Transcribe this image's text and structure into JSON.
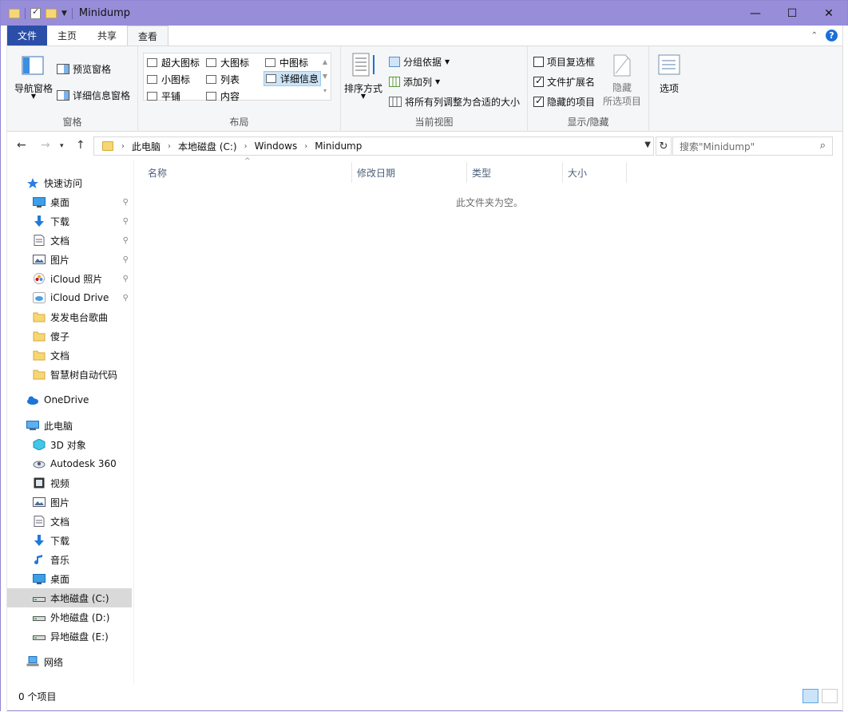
{
  "window": {
    "title": "Minidump"
  },
  "titlebar": {
    "minimize": "—",
    "maximize": "☐",
    "close": "✕"
  },
  "tabs": [
    {
      "label": "文件"
    },
    {
      "label": "主页"
    },
    {
      "label": "共享"
    },
    {
      "label": "查看"
    }
  ],
  "ribbon": {
    "panes": {
      "label": "窗格",
      "nav_pane": "导航窗格",
      "preview_pane": "预览窗格",
      "details_pane": "详细信息窗格"
    },
    "layout": {
      "label": "布局",
      "items": [
        "超大图标",
        "大图标",
        "中图标",
        "小图标",
        "列表",
        "详细信息",
        "平铺",
        "内容"
      ]
    },
    "current_view": {
      "label": "当前视图",
      "sort_by": "排序方式",
      "group_by": "分组依据",
      "add_columns": "添加列",
      "fit_columns": "将所有列调整为合适的大小"
    },
    "show_hide": {
      "label": "显示/隐藏",
      "item_checkboxes": "项目复选框",
      "file_extensions": "文件扩展名",
      "hidden_items": "隐藏的项目",
      "item_checkboxes_checked": false,
      "file_extensions_checked": true,
      "hidden_items_checked": true,
      "hide_selected": "隐藏",
      "hide_selected_line2": "所选项目"
    },
    "options": {
      "label": "选项"
    }
  },
  "address": {
    "crumbs": [
      "此电脑",
      "本地磁盘 (C:)",
      "Windows",
      "Minidump"
    ]
  },
  "search": {
    "placeholder": "搜索\"Minidump\""
  },
  "nav": {
    "quick_access": "快速访问",
    "quick_items": [
      {
        "label": "桌面",
        "pinned": true
      },
      {
        "label": "下载",
        "pinned": true
      },
      {
        "label": "文档",
        "pinned": true
      },
      {
        "label": "图片",
        "pinned": true
      },
      {
        "label": "iCloud 照片",
        "pinned": true
      },
      {
        "label": "iCloud Drive",
        "pinned": true
      },
      {
        "label": "发发电台歌曲",
        "pinned": false
      },
      {
        "label": "傻子",
        "pinned": false
      },
      {
        "label": "文档",
        "pinned": false
      },
      {
        "label": "智慧树自动代码",
        "pinned": false
      }
    ],
    "onedrive": "OneDrive",
    "this_pc": "此电脑",
    "pc_items": [
      {
        "label": "3D 对象"
      },
      {
        "label": "Autodesk 360"
      },
      {
        "label": "视频"
      },
      {
        "label": "图片"
      },
      {
        "label": "文档"
      },
      {
        "label": "下载"
      },
      {
        "label": "音乐"
      },
      {
        "label": "桌面"
      },
      {
        "label": "本地磁盘 (C:)"
      },
      {
        "label": "外地磁盘 (D:)"
      },
      {
        "label": "异地磁盘 (E:)"
      }
    ],
    "network": "网络"
  },
  "list": {
    "columns": [
      "名称",
      "修改日期",
      "类型",
      "大小"
    ],
    "empty_message": "此文件夹为空。"
  },
  "status": {
    "item_count": "0 个项目"
  },
  "colors": {
    "titlebar": "#978dd9",
    "file_tab": "#2b4fa8",
    "selection": "#cce4f7",
    "nav_selected": "#d9d9d9"
  }
}
